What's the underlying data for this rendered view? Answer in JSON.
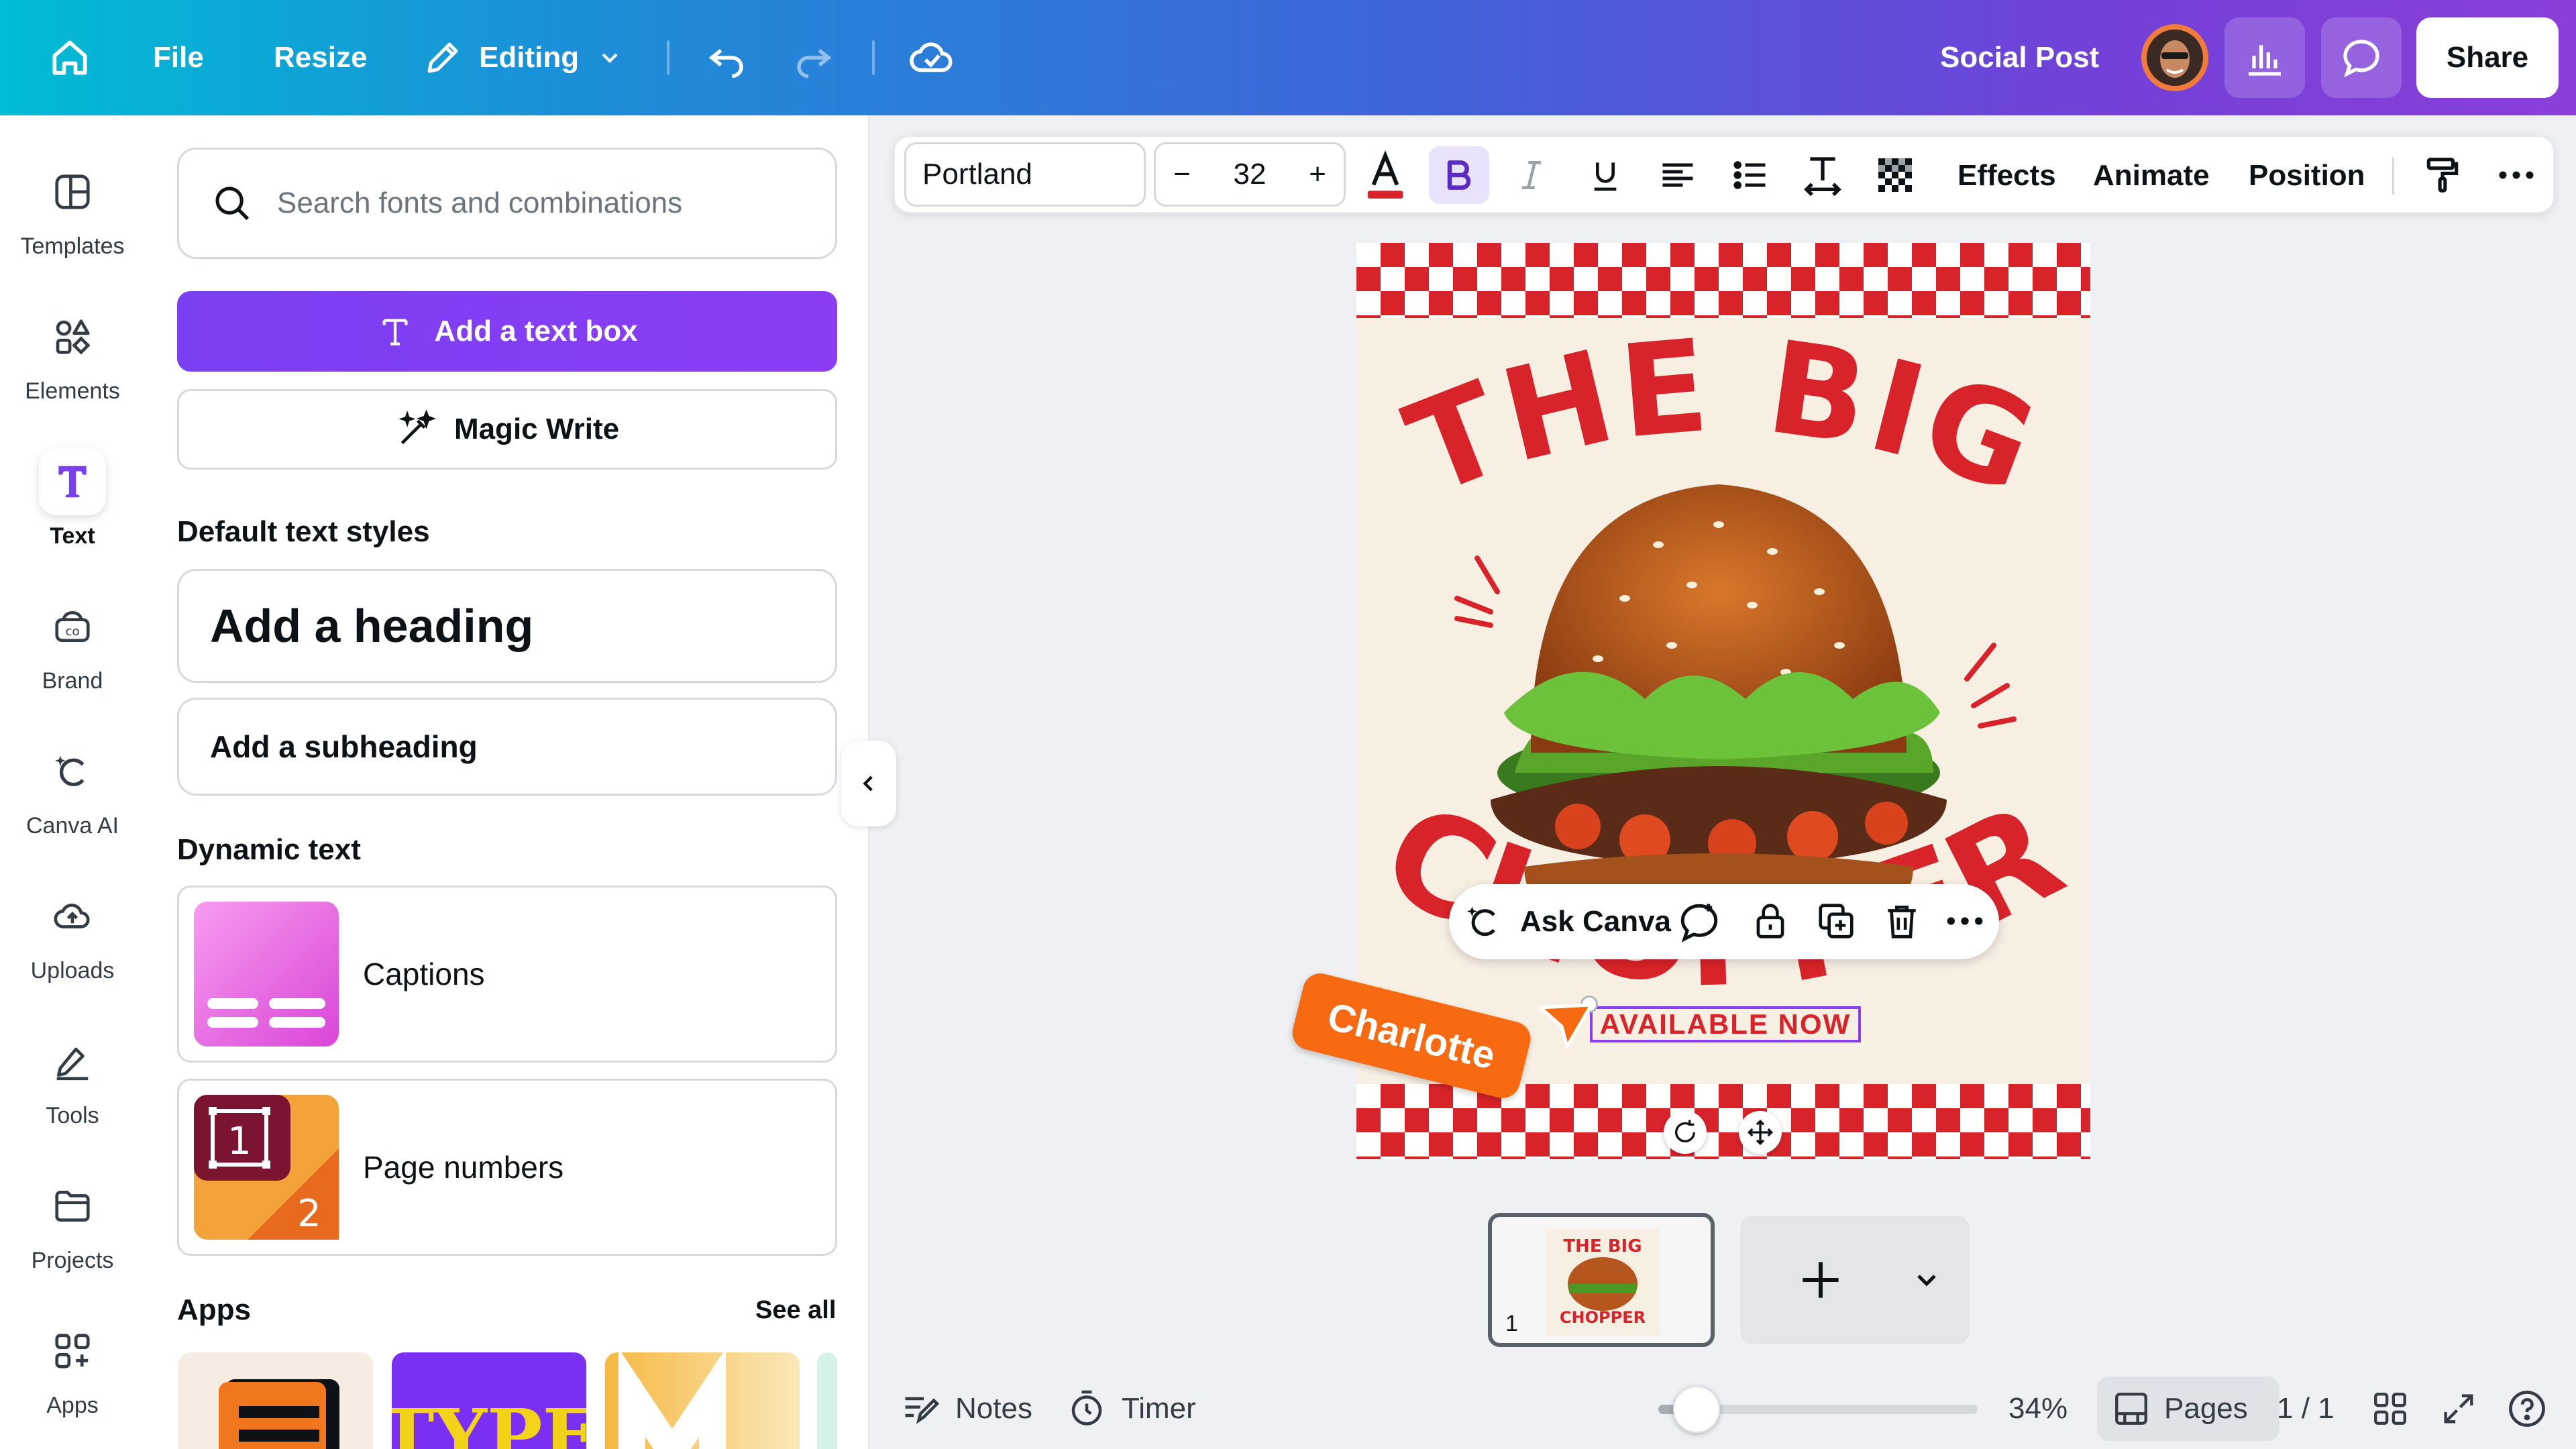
{
  "topbar": {
    "home_icon": "home-icon",
    "file": "File",
    "resize": "Resize",
    "editing": "Editing",
    "title": "Social Post",
    "share": "Share"
  },
  "rail": {
    "items": [
      {
        "label": "Templates",
        "icon": "templates-icon"
      },
      {
        "label": "Elements",
        "icon": "elements-icon"
      },
      {
        "label": "Text",
        "icon": "text-icon"
      },
      {
        "label": "Brand",
        "icon": "brand-icon"
      },
      {
        "label": "Canva AI",
        "icon": "canva-ai-icon"
      },
      {
        "label": "Uploads",
        "icon": "uploads-icon"
      },
      {
        "label": "Tools",
        "icon": "tools-icon"
      },
      {
        "label": "Projects",
        "icon": "projects-icon"
      },
      {
        "label": "Apps",
        "icon": "apps-icon"
      }
    ],
    "active": "Text"
  },
  "panel": {
    "search_placeholder": "Search fonts and combinations",
    "add_text_box": "Add a text box",
    "magic_write": "Magic Write",
    "default_styles_title": "Default text styles",
    "heading": "Add a heading",
    "subheading": "Add a subheading",
    "dynamic_title": "Dynamic text",
    "captions": "Captions",
    "page_numbers": "Page numbers",
    "page_numbers_icon_1": "1",
    "page_numbers_icon_2": "2",
    "apps_title": "Apps",
    "see_all": "See all",
    "app_tile_2": "TYPE"
  },
  "toolbar": {
    "font": "Portland",
    "size": "32",
    "minus": "−",
    "plus": "+",
    "effects": "Effects",
    "animate": "Animate",
    "position": "Position"
  },
  "canvas": {
    "title_line": "THE BIG",
    "subtitle_line": "CHOPPER",
    "available": "AVAILABLE NOW",
    "accent": "#d9232a",
    "bg": "#f8efe3"
  },
  "context_bar": {
    "ask": "Ask Canva"
  },
  "collaborator": {
    "name": "Charlotte",
    "color": "#f76a12"
  },
  "pages": {
    "thumb_number": "1",
    "thumb_title": "THE BIG",
    "thumb_subtitle": "CHOPPER"
  },
  "bottom": {
    "notes": "Notes",
    "timer": "Timer",
    "zoom": "34%",
    "zoom_fraction": 0.12,
    "pages": "Pages",
    "page_count": "1 / 1"
  }
}
